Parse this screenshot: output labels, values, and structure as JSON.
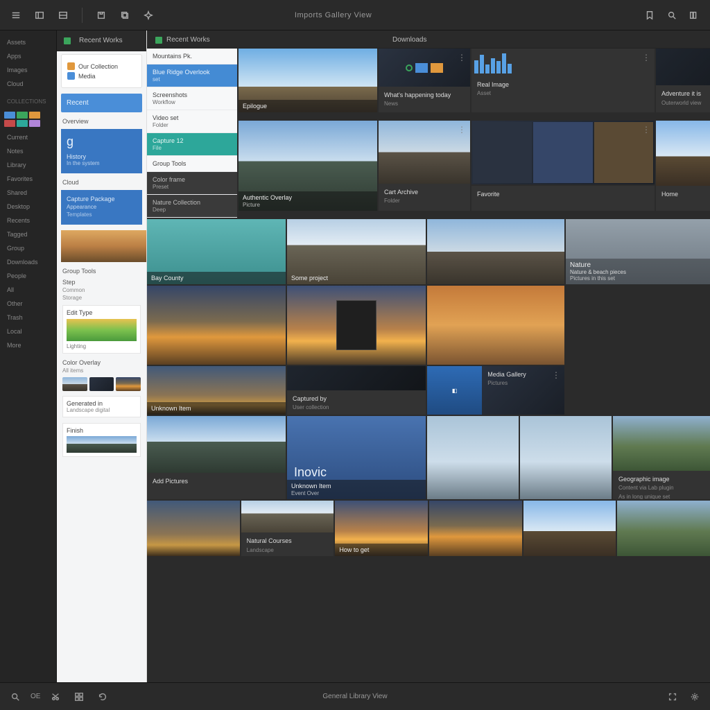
{
  "topbar": {
    "breadcrumb": "Imports   Gallery   View"
  },
  "rail": {
    "items": [
      "Assets",
      "Apps",
      "Images",
      "Cloud",
      "",
      "Collections",
      "",
      "",
      "Current",
      "Notes",
      "Library",
      "",
      "Favorites",
      "",
      "",
      "Shared",
      "Desktop",
      "Recents",
      "",
      "Tagged",
      "Group",
      "Downloads",
      "",
      "People",
      "",
      "",
      "All",
      "Other",
      "Trash",
      "",
      "",
      "Local",
      "More"
    ]
  },
  "sidebar": {
    "header": "Recent Works",
    "card1": {
      "title": "Our Collection",
      "sub": "Media"
    },
    "blue1": "Recent",
    "sep1": "Overview",
    "bigG": "g",
    "blue2a": "History",
    "blue2b": "In the system",
    "grey1": "Cloud",
    "row1": "Capture Package",
    "row2": "Appearance",
    "row3": "Templates",
    "sep2": "Group Tools",
    "sep3": "Step",
    "sep3b": "Common",
    "sep3c": "Storage",
    "label1": "Edit Type",
    "palette_title": "Lighting",
    "col_sub": "Color Overlay",
    "col_sub2": "All items",
    "gen_title": "Generated in",
    "gen_sub": "Landscape digital",
    "final_label": "Finish"
  },
  "main": {
    "header1": "Recent Works",
    "header2": "Downloads",
    "col2": {
      "r1": "Mountains Pk.",
      "r2_t": "Blue Ridge Overlook",
      "r2_s": "set",
      "r3_t": "Screenshots",
      "r3_s": "Workflow",
      "r4_t": "Video set",
      "r4_s": "Folder",
      "r5_t": "Capture 12",
      "r5_s": "File",
      "r6": "Group Tools",
      "r7_t": "Color frame",
      "r7_s": "Preset",
      "r8_t": "Nature Collection",
      "r8_s": "Deep"
    },
    "cards": {
      "a1": "Epilogue",
      "a2": "Authentic",
      "a3": "Authentic Overlay",
      "a3s": "Picture",
      "b1_t": "What's happening today",
      "b1_s": "News",
      "b2_t": "Real Image",
      "b2_s": "Asset",
      "b3_t": "Adventure it is",
      "b3_s": "Outerworld view",
      "c1_t": "Cart Archive",
      "c1_s": "Folder",
      "c2_t": "Favorite",
      "d1": "Bay County",
      "d1s": "Some project",
      "d2": "Home",
      "e1": "Captured by",
      "e1s": "User collection",
      "e2": "Home",
      "e2s": "Asset",
      "e3_t": "Media Gallery",
      "e3_s": "Pictures",
      "f1_t": "Nature",
      "f1_s": "Nature & beach pieces",
      "f1_s2": "Pictures in this set",
      "g1": "Add Pictures",
      "g2": "Inovic",
      "g2s": "Unknown Item",
      "g3": "Event Over",
      "h1": "Natural Courses",
      "h1s": "Landscape",
      "h2": "How to get",
      "i1_t": "Geographic image",
      "i1_s": "Content via Lab plugin",
      "i1_s2": "As in long unique set"
    }
  },
  "status": {
    "center": "General Library View",
    "left1": "OE"
  }
}
